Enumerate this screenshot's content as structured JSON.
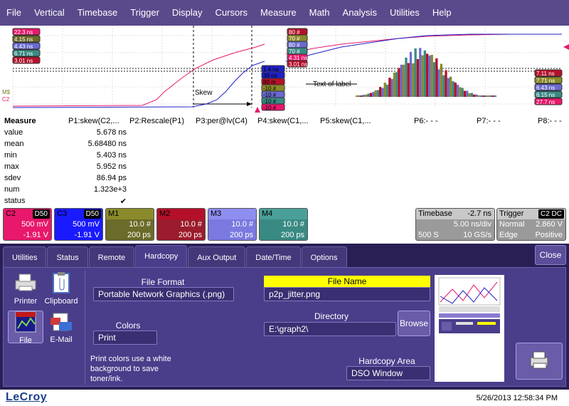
{
  "menu": [
    "File",
    "Vertical",
    "Timebase",
    "Trigger",
    "Display",
    "Cursors",
    "Measure",
    "Math",
    "Analysis",
    "Utilities",
    "Help"
  ],
  "display": {
    "left_tags": [
      "22.3 ns",
      "4.15 ns",
      "4.43 ns",
      "6.71 ns",
      "3.01 ns"
    ],
    "mid_tags": [
      "1 4 ns",
      "39 ns",
      "80 m",
      "-10 #",
      "-10 #",
      "-10 #",
      "-10 #"
    ],
    "histo_tags": [
      "80 #",
      "70 #",
      "80 #",
      "70 #",
      "4.31 ns",
      "3.01 ns"
    ],
    "right_tags": [
      "7.11 ns",
      "7.71 ns",
      "6.43 ns",
      "6.15 ns",
      "27.7 ns"
    ],
    "skew_label": "Skew",
    "text_label": "Text of label",
    "ms_marker": "M$",
    "c2_marker": "C2"
  },
  "measure": {
    "title": "Measure",
    "columns": [
      "P1:skew(C2,...",
      "P2:Rescale(P1)",
      "P3:per@lv(C4)",
      "P4:skew(C1,...",
      "P5:skew(C1,...",
      "P6:- - -",
      "P7:- - -",
      "P8:- - -"
    ],
    "rows": [
      {
        "label": "value",
        "val": "5.678 ns"
      },
      {
        "label": "mean",
        "val": "5.68480 ns"
      },
      {
        "label": "min",
        "val": "5.403 ns"
      },
      {
        "label": "max",
        "val": "5.952 ns"
      },
      {
        "label": "sdev",
        "val": "86.94 ps"
      },
      {
        "label": "num",
        "val": "1.323e+3"
      },
      {
        "label": "status",
        "val": "✔"
      }
    ]
  },
  "descriptors": [
    {
      "name": "C2",
      "tag": "D50",
      "line1": "500 mV",
      "line2": "-1.91 V",
      "color": "#e8186c",
      "head_color": "#e8186c"
    },
    {
      "name": "C3",
      "tag": "D50",
      "line1": "500 mV",
      "line2": "-1.91 V",
      "color": "#1a1aff",
      "head_color": "#1a1aff"
    },
    {
      "name": "M1",
      "tag": "",
      "line1": "10.0 #",
      "line2": "200 ps",
      "color": "#6b6b2a",
      "head_color": "#8a8a2a"
    },
    {
      "name": "M2",
      "tag": "",
      "line1": "10.0 #",
      "line2": "200 ps",
      "color": "#9b1c2c",
      "head_color": "#b5102a"
    },
    {
      "name": "M3",
      "tag": "",
      "line1": "10.0 #",
      "line2": "200 ps",
      "color": "#7a7ae0",
      "head_color": "#8e8ef0"
    },
    {
      "name": "M4",
      "tag": "",
      "line1": "10.0 #",
      "line2": "200 ps",
      "color": "#3a8a84",
      "head_color": "#4aa098"
    }
  ],
  "timebase": {
    "title": "Timebase",
    "delay": "-2.7 ns",
    "scale": "5.00 ns/div",
    "samples": "500 S",
    "rate": "10 GS/s"
  },
  "trigger": {
    "title": "Trigger",
    "tags": "C2 DC",
    "mode": "Normal",
    "level": "2.860 V",
    "type": "Edge",
    "slope": "Positive"
  },
  "dialog": {
    "tabs": [
      "Utilities",
      "Status",
      "Remote",
      "Hardcopy",
      "Aux Output",
      "Date/Time",
      "Options"
    ],
    "active_tab": "Hardcopy",
    "close_label": "Close",
    "devices": [
      "Printer",
      "Clipboard",
      "File",
      "E-Mail"
    ],
    "file_format_title": "File Format",
    "file_format": "Portable Network Graphics (.png)",
    "colors_title": "Colors",
    "colors": "Print",
    "note": "Print colors use a white background to save toner/ink.",
    "file_name_title": "File Name",
    "file_name": "p2p_jitter.png",
    "directory_title": "Directory",
    "directory": "E:\\graph2\\",
    "browse_label": "Browse",
    "hardcopy_area_title": "Hardcopy Area",
    "hardcopy_area": "DSO Window"
  },
  "status": {
    "logo": "LeCroy",
    "datetime": "5/26/2013 12:58:34 PM"
  }
}
